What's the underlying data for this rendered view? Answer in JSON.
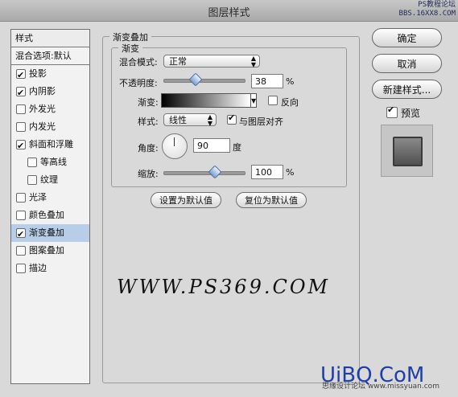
{
  "window": {
    "title": "图层样式"
  },
  "watermark_top": "PS教程论坛\nBBS.16XX8.COM",
  "styles_panel": {
    "header": "样式",
    "blend_options": "混合选项:默认",
    "items": [
      {
        "label": "投影",
        "checked": true,
        "indent": false,
        "selected": false
      },
      {
        "label": "内阴影",
        "checked": true,
        "indent": false,
        "selected": false
      },
      {
        "label": "外发光",
        "checked": false,
        "indent": false,
        "selected": false
      },
      {
        "label": "内发光",
        "checked": false,
        "indent": false,
        "selected": false
      },
      {
        "label": "斜面和浮雕",
        "checked": true,
        "indent": false,
        "selected": false
      },
      {
        "label": "等高线",
        "checked": false,
        "indent": true,
        "selected": false
      },
      {
        "label": "纹理",
        "checked": false,
        "indent": true,
        "selected": false
      },
      {
        "label": "光泽",
        "checked": false,
        "indent": false,
        "selected": false
      },
      {
        "label": "颜色叠加",
        "checked": false,
        "indent": false,
        "selected": false
      },
      {
        "label": "渐变叠加",
        "checked": true,
        "indent": false,
        "selected": true
      },
      {
        "label": "图案叠加",
        "checked": false,
        "indent": false,
        "selected": false
      },
      {
        "label": "描边",
        "checked": false,
        "indent": false,
        "selected": false
      }
    ]
  },
  "gradient_overlay": {
    "group_title": "渐变叠加",
    "subgroup_title": "渐变",
    "blend_mode_label": "混合模式:",
    "blend_mode_value": "正常",
    "opacity_label": "不透明度:",
    "opacity_value": "38",
    "opacity_unit": "%",
    "opacity_fraction": 0.38,
    "gradient_label": "渐变:",
    "reverse_label": "反向",
    "reverse_checked": false,
    "style_label": "样式:",
    "style_value": "线性",
    "align_label": "与图层对齐",
    "align_checked": true,
    "angle_label": "角度:",
    "angle_value": "90",
    "angle_unit": "度",
    "scale_label": "缩放:",
    "scale_value": "100",
    "scale_unit": "%",
    "scale_fraction": 0.62,
    "make_default": "设置为默认值",
    "reset_default": "复位为默认值"
  },
  "actions": {
    "ok": "确定",
    "cancel": "取消",
    "new_style": "新建样式...",
    "preview_label": "预览",
    "preview_checked": true
  },
  "site_watermark": "WWW.PS369.COM",
  "brand_watermark": "UiBQ.CoM",
  "brand_sub": "思缘设计论坛 www.missyuan.com"
}
